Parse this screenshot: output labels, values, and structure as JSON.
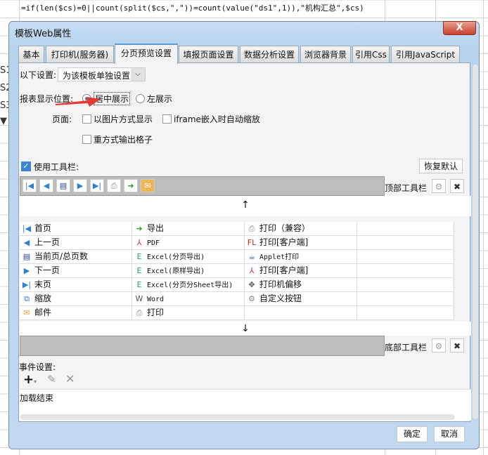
{
  "sheet": {
    "formula": "=if(len($cs)=0||count(split($cs,\",\"))=count(value(\"ds1\",1)),\"机构汇总\",$cs)",
    "row_headers": [
      "S1",
      "S2",
      "S3",
      "▼"
    ]
  },
  "dialog": {
    "title": "模板Web属性",
    "close": "X",
    "tabs": [
      "基本",
      "打印机(服务器)",
      "分页预览设置",
      "填报页面设置",
      "数据分析设置",
      "浏览器背景",
      "引用Css",
      "引用JavaScript"
    ],
    "active_tab": "分页预览设置",
    "settings_label": "以下设置:",
    "settings_value": "为该模板单独设置",
    "position_label": "报表显示位置:",
    "position_options": [
      "居中展示",
      "左展示"
    ],
    "position_selected": "居中展示",
    "page_label": "页面:",
    "page_options": [
      "以图片方式显示",
      "iframe嵌入时自动缩放",
      "重方式输出格子"
    ],
    "use_toolbar_label": "使用工具栏:",
    "use_toolbar_checked": true,
    "restore_default": "恢复默认",
    "top_toolbar_label": "顶部工具栏",
    "bottom_toolbar_label": "底部工具栏",
    "button_grid": [
      [
        {
          "icon": "first",
          "label": "首页"
        },
        {
          "icon": "export",
          "label": "导出"
        },
        {
          "icon": "print",
          "label": "打印（兼容）"
        }
      ],
      [
        {
          "icon": "prev",
          "label": "上一页"
        },
        {
          "icon": "pdf",
          "label": "PDF"
        },
        {
          "icon": "flash-print",
          "label": "打印[客户端]"
        }
      ],
      [
        {
          "icon": "page-count",
          "label": "当前页/总页数"
        },
        {
          "icon": "excel",
          "label": "Excel(分页导出)"
        },
        {
          "icon": "applet",
          "label": "Applet打印"
        }
      ],
      [
        {
          "icon": "next",
          "label": "下一页"
        },
        {
          "icon": "excel",
          "label": "Excel(原样导出)"
        },
        {
          "icon": "pdf-print",
          "label": "打印[客户端]"
        }
      ],
      [
        {
          "icon": "last",
          "label": "末页"
        },
        {
          "icon": "excel",
          "label": "Excel(分页分Sheet导出)"
        },
        {
          "icon": "move",
          "label": "打印机偏移"
        }
      ],
      [
        {
          "icon": "zoom",
          "label": "缩放"
        },
        {
          "icon": "word",
          "label": "Word"
        },
        {
          "icon": "gear",
          "label": "自定义按钮"
        }
      ],
      [
        {
          "icon": "email",
          "label": "邮件"
        },
        {
          "icon": "print",
          "label": "打印"
        },
        {
          "icon": "",
          "label": ""
        }
      ]
    ],
    "events_label": "事件设置:",
    "events": [
      "加载结束"
    ],
    "ok": "确定",
    "cancel": "取消"
  },
  "colors": {
    "accent": "#5b9bd5",
    "arrow": "#e53935",
    "toolbar_bg": "#bdbdbd"
  }
}
